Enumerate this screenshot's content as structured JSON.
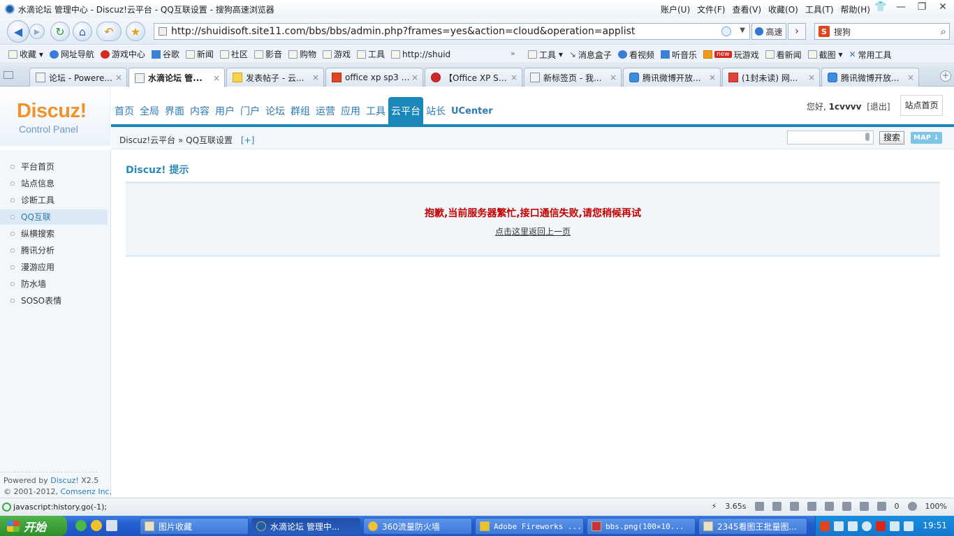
{
  "window": {
    "title": "水滴论坛 管理中心 - Discuz!云平台 - QQ互联设置 - 搜狗高速浏览器",
    "menus": [
      "账户(U)",
      "文件(F)",
      "查看(V)",
      "收藏(O)",
      "工具(T)",
      "帮助(H)"
    ]
  },
  "toolbar": {
    "url": "http://shuidisoft.site11.com/bbs/bbs/admin.php?frames=yes&action=cloud&operation=applist",
    "speed_label": "高速",
    "search_placeholder": "搜狗"
  },
  "bookmarks": {
    "left": [
      "收藏",
      "网址导航",
      "游戏中心",
      "谷歌",
      "新闻",
      "社区",
      "影音",
      "购物",
      "游戏",
      "工具",
      "http://shuid"
    ],
    "right": [
      "工具",
      "消息盒子",
      "看视频",
      "听音乐",
      "玩游戏",
      "看新闻",
      "截图",
      "常用工具"
    ],
    "new_badge": "new"
  },
  "tabs": [
    {
      "label": "论坛 - Powere..."
    },
    {
      "label": "水滴论坛 管..."
    },
    {
      "label": "发表帖子 - 云..."
    },
    {
      "label": "office xp sp3 - ..."
    },
    {
      "label": "【Office XP SP..."
    },
    {
      "label": "新标签页 - 我..."
    },
    {
      "label": "腾讯微博开放..."
    },
    {
      "label": "(1封未读) 网..."
    },
    {
      "label": "腾讯微博开放..."
    }
  ],
  "discuz": {
    "logo_main": "Discuz!",
    "logo_sub": "Control Panel",
    "nav": [
      "首页",
      "全局",
      "界面",
      "内容",
      "用户",
      "门户",
      "论坛",
      "群组",
      "运营",
      "应用",
      "工具",
      "云平台",
      "站长",
      "UCenter"
    ],
    "active_nav": "云平台",
    "greeting": "您好,",
    "username": "1cvvvv",
    "logout": "[退出]",
    "home_button": "站点首页",
    "breadcrumb_root": "Discuz!云平台",
    "breadcrumb_sep": "»",
    "breadcrumb_current": "QQ互联设置",
    "breadcrumb_plus": "[+]",
    "search_button": "搜索",
    "map_button": "MAP ↓"
  },
  "sidebar": {
    "items": [
      "平台首页",
      "站点信息",
      "诊断工具",
      "QQ互联",
      "纵横搜索",
      "腾讯分析",
      "漫游应用",
      "防水墙",
      "SOSO表情"
    ],
    "active": "QQ互联",
    "powered_by": "Powered by",
    "powered_name": "Discuz!",
    "powered_ver": "X2.5",
    "copyright_prefix": "© 2001-2012,",
    "copyright_name": "Comsenz Inc."
  },
  "content": {
    "tip_title": "Discuz! 提示",
    "error_message": "抱歉,当前服务器繁忙,接口通信失败,请您稍候再试",
    "back_link": "点击这里返回上一页"
  },
  "statusbar": {
    "text": "javascript:history.go(-1);",
    "speed": "3.65s",
    "counter": "0",
    "zoom": "100%"
  },
  "taskbar": {
    "start": "开始",
    "items": [
      "图片收藏",
      "水滴论坛 管理中...",
      "360流量防火墙",
      "Adobe Fireworks ...",
      "bbs.png(100×10...",
      "2345看图王批量图..."
    ],
    "clock": "19:51"
  }
}
